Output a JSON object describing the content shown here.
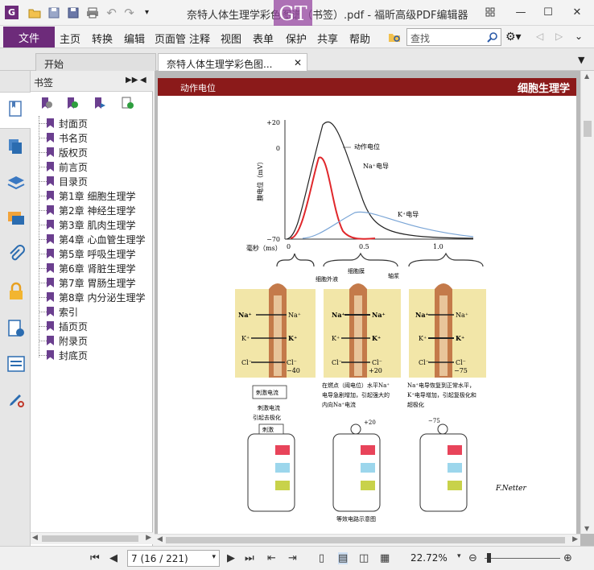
{
  "app": {
    "title": "奈特人体生理学彩色图谱（书签）.pdf - 福昕高级PDF编辑器",
    "watermark": "GT"
  },
  "menu": {
    "file": "文件",
    "items": [
      "主页",
      "转换",
      "编辑",
      "页面管",
      "注释",
      "视图",
      "表单",
      "保护",
      "共享",
      "帮助"
    ],
    "search_placeholder": "查找"
  },
  "tabs": [
    {
      "label": "开始"
    },
    {
      "label": "奈特人体生理学彩色图..."
    }
  ],
  "bookmarks": {
    "header": "书签",
    "items": [
      "封面页",
      "书名页",
      "版权页",
      "前言页",
      "目录页",
      "第1章 细胞生理学",
      "第2章 神经生理学",
      "第3章 肌肉生理学",
      "第4章 心血管生理学",
      "第5章 呼吸生理学",
      "第6章 肾脏生理学",
      "第7章 胃肠生理学",
      "第8章 内分泌生理学",
      "索引",
      "插页页",
      "附录页",
      "封底页"
    ]
  },
  "page": {
    "header_left": "动作电位",
    "header_right": "细胞生理学",
    "figure": {
      "ylabel": "膜电位（mV）",
      "y_ticks": [
        "+20",
        "0",
        "−70"
      ],
      "x_label": "毫秒（ms）",
      "x_ticks": [
        "0",
        "0.5",
        "1.0"
      ],
      "curve_labels": [
        "动作电位",
        "Na⁺电导",
        "K⁺电导"
      ],
      "membrane_labels": [
        "细胞外液",
        "细胞膜",
        "轴浆"
      ],
      "ions": [
        "Na⁺",
        "K⁺",
        "Cl⁻"
      ],
      "potentials": [
        "−40",
        "+20",
        "−75"
      ],
      "stim_box": "刺激电流",
      "caption_left": [
        "刺激电流",
        "引起去极化"
      ],
      "caption_mid": [
        "在燃点（阈电位）水平Na⁺",
        "电导急剧增加，引起强大的",
        "内向Na⁺电流"
      ],
      "caption_right": [
        "Na⁺电导恢复到正常水平，",
        "K⁺电导增加，引起复极化和",
        "超极化"
      ],
      "circuit_stim": "刺激",
      "circuit_vals": [
        "+20",
        "−75"
      ],
      "circuit_caption": "等效电路示意图",
      "signature": "F.Netter"
    }
  },
  "status": {
    "page_indicator": "7 (16 / 221)",
    "zoom": "22.72%"
  },
  "colors": {
    "accent": "#6d2b7a",
    "page_header": "#8b1a1a",
    "action_potential": "#222222",
    "na_conductance": "#e0272b",
    "k_conductance": "#7aa5d6"
  }
}
